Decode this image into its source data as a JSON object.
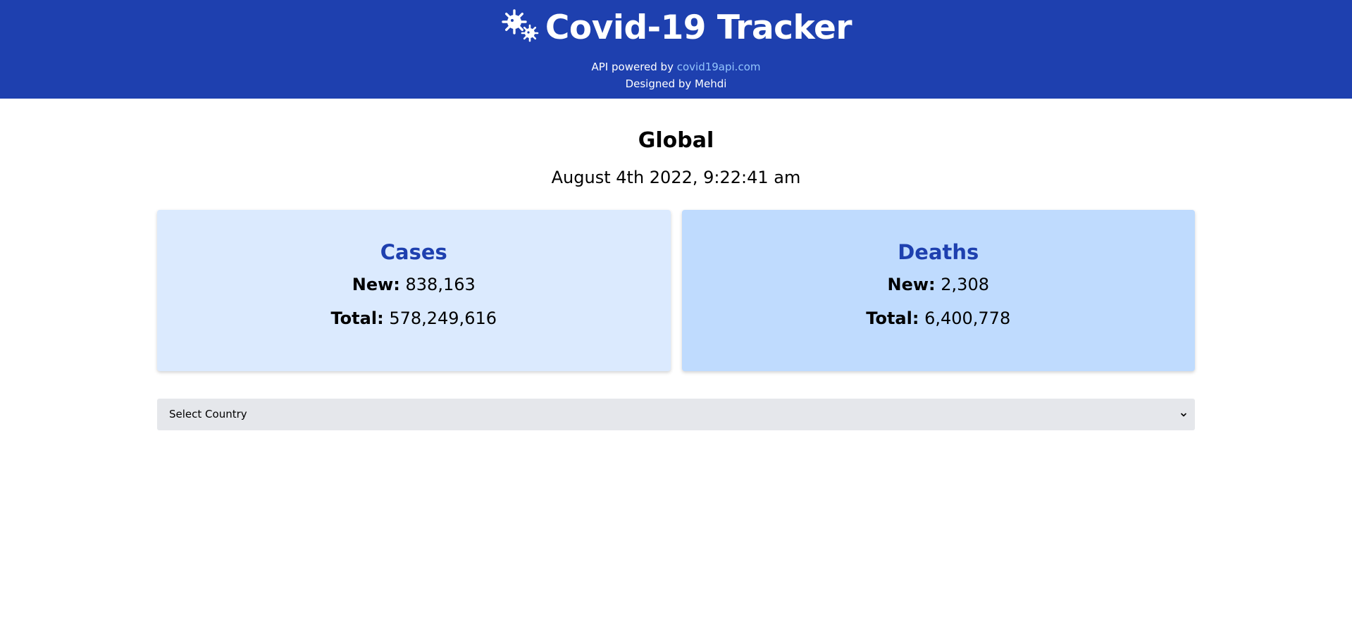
{
  "header": {
    "title": "Covid-19 Tracker",
    "api_prefix": "API powered by ",
    "api_link": "covid19api.com",
    "designer": "Designed by Mehdi",
    "logo_icon": "virus-icon",
    "background_color": "#1e40af",
    "link_color": "#93c5fd"
  },
  "summary": {
    "region": "Global",
    "timestamp": "August 4th 2022, 9:22:41 am"
  },
  "cards": {
    "cases": {
      "title": "Cases",
      "new_label": "New:",
      "new_value": "838,163",
      "total_label": "Total:",
      "total_value": "578,249,616",
      "background_color": "#dbeafe"
    },
    "deaths": {
      "title": "Deaths",
      "new_label": "New:",
      "new_value": "2,308",
      "total_label": "Total:",
      "total_value": "6,400,778",
      "background_color": "#bfdbfe"
    }
  },
  "country_select": {
    "selected": "Select Country",
    "arrow_icon": "chevron-down-icon"
  }
}
